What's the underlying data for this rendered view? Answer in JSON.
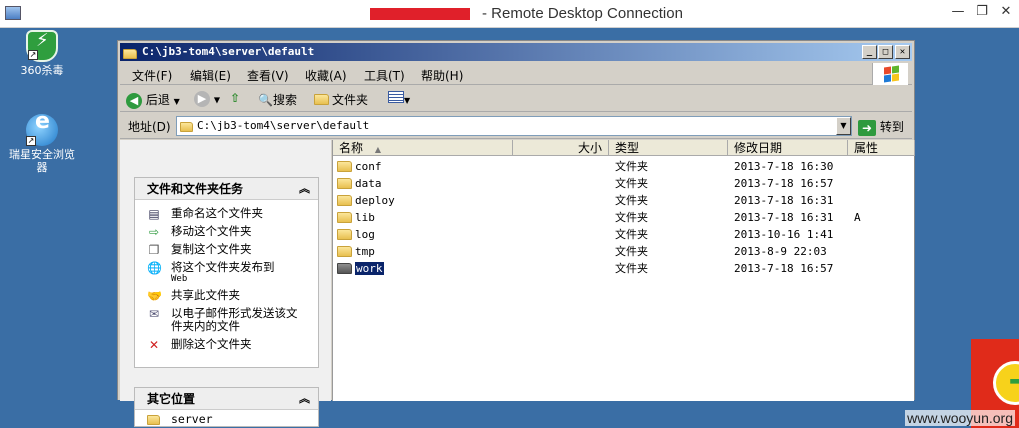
{
  "rdp": {
    "title": "- Remote Desktop Connection",
    "minimize": "—",
    "restore": "❐",
    "close": "✕"
  },
  "desktop": {
    "icons": [
      {
        "label": "360杀毒",
        "icon": "shield-icon"
      },
      {
        "label": "瑞星安全浏览器",
        "icon": "browser-icon"
      }
    ],
    "watermark": "www.wooyun.org"
  },
  "explorer": {
    "title": "C:\\jb3-tom4\\server\\default",
    "menu": [
      "文件(F)",
      "编辑(E)",
      "查看(V)",
      "收藏(A)",
      "工具(T)",
      "帮助(H)"
    ],
    "toolbar": {
      "back": "后退",
      "search": "搜索",
      "folders": "文件夹"
    },
    "address": {
      "label": "地址(D)",
      "value": "C:\\jb3-tom4\\server\\default",
      "go": "转到"
    },
    "tasks": {
      "header": "文件和文件夹任务",
      "items": [
        {
          "label": "重命名这个文件夹",
          "icon": "rename-icon"
        },
        {
          "label": "移动这个文件夹",
          "icon": "move-icon"
        },
        {
          "label": "复制这个文件夹",
          "icon": "copy-icon"
        },
        {
          "label": "将这个文件夹发布到",
          "sub": "Web",
          "icon": "globe-icon"
        },
        {
          "label": "共享此文件夹",
          "icon": "share-icon"
        },
        {
          "label": "以电子邮件形式发送该文件夹内的文件",
          "icon": "email-icon"
        },
        {
          "label": "删除这个文件夹",
          "icon": "delete-icon"
        }
      ]
    },
    "other_places": {
      "header": "其它位置",
      "items": [
        "server"
      ]
    },
    "columns": [
      "名称",
      "大小",
      "类型",
      "修改日期",
      "属性"
    ],
    "files": [
      {
        "name": "conf",
        "type": "文件夹",
        "modified": "2013-7-18 16:30",
        "attr": ""
      },
      {
        "name": "data",
        "type": "文件夹",
        "modified": "2013-7-18 16:57",
        "attr": ""
      },
      {
        "name": "deploy",
        "type": "文件夹",
        "modified": "2013-7-18 16:31",
        "attr": ""
      },
      {
        "name": "lib",
        "type": "文件夹",
        "modified": "2013-7-18 16:31",
        "attr": "A"
      },
      {
        "name": "log",
        "type": "文件夹",
        "modified": "2013-10-16 1:41",
        "attr": ""
      },
      {
        "name": "tmp",
        "type": "文件夹",
        "modified": "2013-8-9 22:03",
        "attr": ""
      },
      {
        "name": "work",
        "type": "文件夹",
        "modified": "2013-7-18 16:57",
        "attr": "",
        "selected": true
      }
    ]
  }
}
